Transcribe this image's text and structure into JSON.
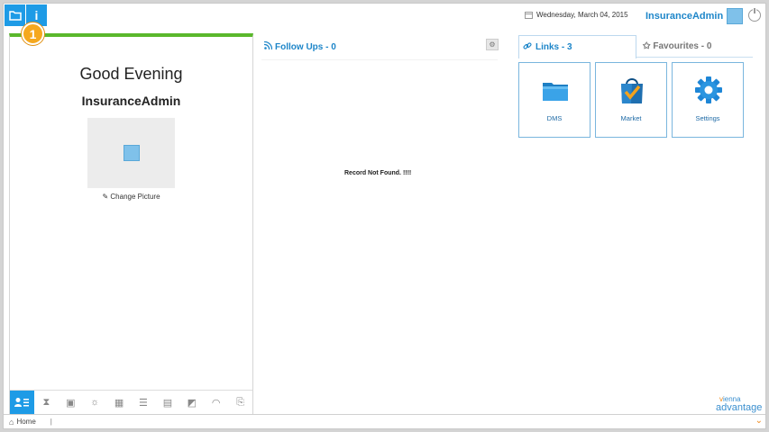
{
  "topbar": {
    "date": "Wednesday, March 04, 2015",
    "user_name": "InsuranceAdmin",
    "info_glyph": "i",
    "step_badge": "1"
  },
  "left_panel": {
    "greeting": "Good Evening",
    "user_name": "InsuranceAdmin",
    "change_picture": "Change Picture"
  },
  "follow_ups": {
    "title": "Follow Ups - 0",
    "empty_message": "Record Not Found. !!!!"
  },
  "right_panel": {
    "tab_links": "Links - 3",
    "tab_favourites": "Favourites - 0",
    "tiles": [
      {
        "label": "DMS",
        "icon": "folder-icon"
      },
      {
        "label": "Market",
        "icon": "shopping-bag-icon"
      },
      {
        "label": "Settings",
        "icon": "gear-icon"
      }
    ]
  },
  "logo": {
    "top": "vienna",
    "bottom": "advantage"
  },
  "footer": {
    "home": "Home",
    "separator": "|"
  },
  "colors": {
    "accent": "#1e9be6",
    "brand_text": "#1e86c9",
    "green_bar": "#5ab82c",
    "badge": "#f5a81e"
  }
}
